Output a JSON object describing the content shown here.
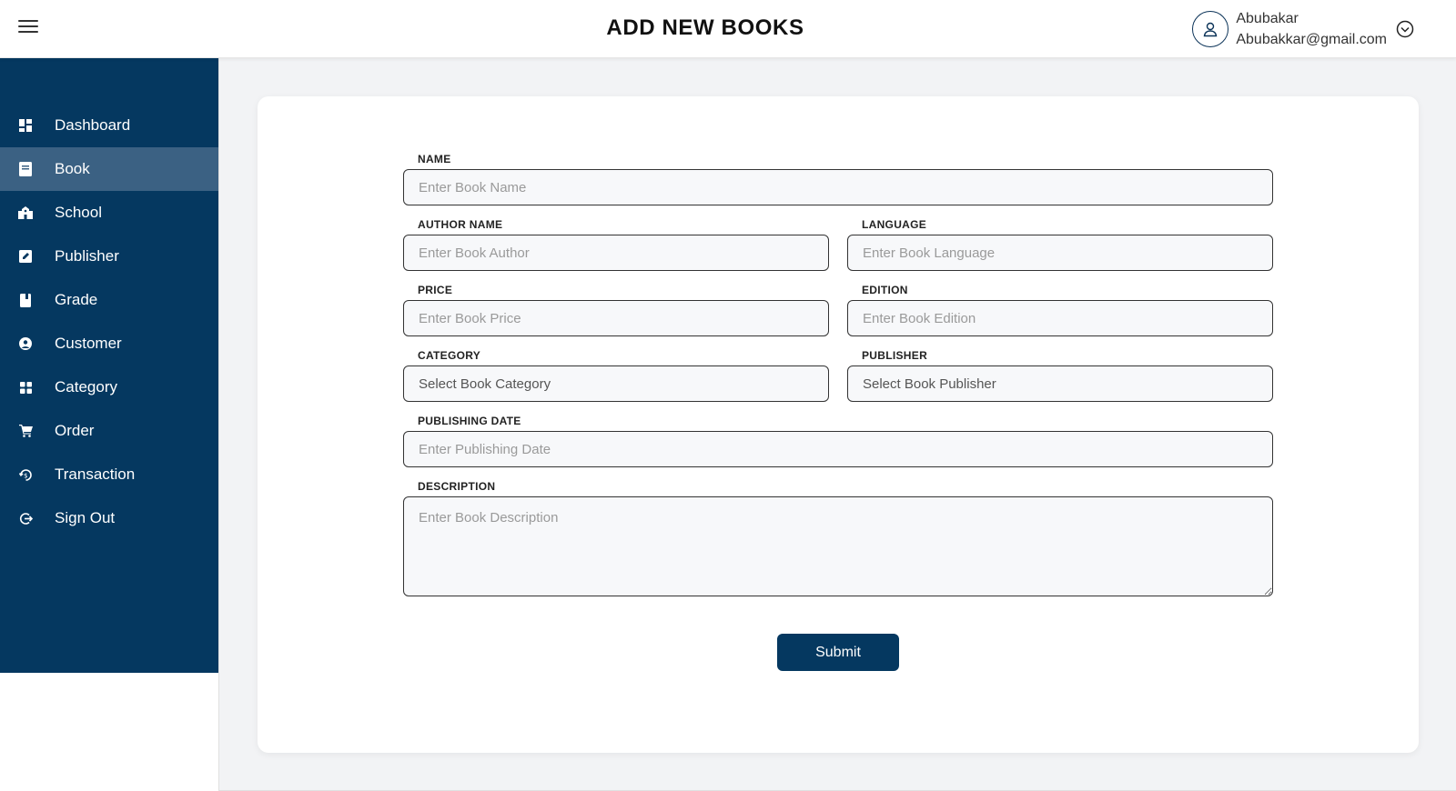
{
  "header": {
    "title": "ADD NEW BOOKS",
    "user_name": "Abubakar",
    "user_email": "Abubakkar@gmail.com"
  },
  "sidebar": {
    "items": [
      {
        "label": "Dashboard",
        "icon": "dashboard-icon"
      },
      {
        "label": "Book",
        "icon": "book-icon",
        "active": true
      },
      {
        "label": "School",
        "icon": "school-icon"
      },
      {
        "label": "Publisher",
        "icon": "publisher-icon"
      },
      {
        "label": "Grade",
        "icon": "grade-icon"
      },
      {
        "label": "Customer",
        "icon": "customer-icon"
      },
      {
        "label": "Category",
        "icon": "category-icon"
      },
      {
        "label": "Order",
        "icon": "cart-icon"
      },
      {
        "label": "Transaction",
        "icon": "transaction-icon"
      },
      {
        "label": "Sign Out",
        "icon": "sign-out-icon"
      }
    ]
  },
  "form": {
    "name": {
      "label": "NAME",
      "placeholder": "Enter Book Name"
    },
    "author": {
      "label": "AUTHOR NAME",
      "placeholder": "Enter Book Author"
    },
    "language": {
      "label": "LANGUAGE",
      "placeholder": "Enter Book Language"
    },
    "price": {
      "label": "PRICE",
      "placeholder": "Enter Book Price"
    },
    "edition": {
      "label": "EDITION",
      "placeholder": "Enter Book Edition"
    },
    "category": {
      "label": "CATEGORY",
      "value": "Select Book Category"
    },
    "publisher": {
      "label": "PUBLISHER",
      "value": "Select Book Publisher"
    },
    "publishing_date": {
      "label": "PUBLISHING DATE",
      "placeholder": "Enter Publishing Date"
    },
    "description": {
      "label": "DESCRIPTION",
      "placeholder": "Enter Book Description"
    },
    "submit_label": "Submit"
  },
  "colors": {
    "sidebar_bg": "#053860",
    "sidebar_active": "#3b6183",
    "button_bg": "#053860"
  }
}
